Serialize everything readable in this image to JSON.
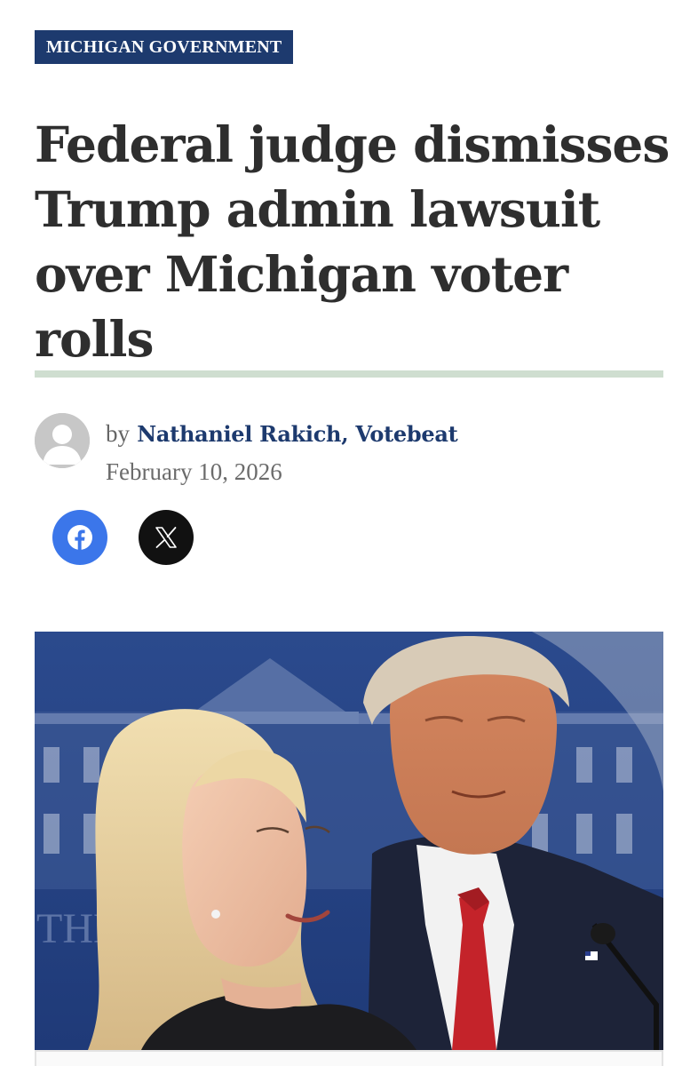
{
  "article": {
    "category": "MICHIGAN GOVERNMENT",
    "headline": "Federal judge dismisses Trump admin lawsuit over Michigan voter rolls",
    "byline_prefix": "by",
    "author": "Nathaniel Rakich, Votebeat",
    "date": "February 10, 2026"
  },
  "share": {
    "facebook_icon": "facebook-icon",
    "x_icon": "x-icon"
  },
  "image": {
    "description": "press-briefing-photo"
  },
  "colors": {
    "brand_navy": "#1d3a6e",
    "rule_green": "#cfded0",
    "facebook_blue": "#3b76ea",
    "headline_text": "#2e2e2e"
  }
}
